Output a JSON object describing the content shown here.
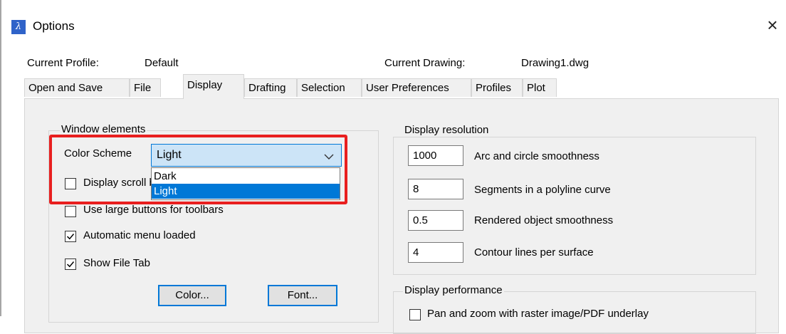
{
  "window": {
    "title": "Options",
    "close_glyph": "×"
  },
  "profile": {
    "label": "Current Profile:",
    "value": "Default"
  },
  "drawing": {
    "label": "Current Drawing:",
    "value": "Drawing1.dwg"
  },
  "tabs": [
    {
      "label": "Open and Save"
    },
    {
      "label": "File"
    },
    {
      "label": "Display",
      "active": true
    },
    {
      "label": "Drafting"
    },
    {
      "label": "Selection"
    },
    {
      "label": "User Preferences"
    },
    {
      "label": "Profiles"
    },
    {
      "label": "Plot"
    }
  ],
  "window_elements": {
    "title": "Window elements",
    "color_scheme": {
      "label": "Color Scheme",
      "value": "Light",
      "options": [
        "Dark",
        "Light"
      ],
      "selected": "Light"
    },
    "checkboxes": {
      "display_scroll": {
        "label": "Display scroll bars",
        "checked": false
      },
      "large_buttons": {
        "label": "Use large buttons for toolbars",
        "checked": false
      },
      "auto_menu": {
        "label": "Automatic menu loaded",
        "checked": true
      },
      "file_tab": {
        "label": "Show File Tab",
        "checked": true
      }
    },
    "color_button": "Color...",
    "font_button": "Font..."
  },
  "display_resolution": {
    "title": "Display resolution",
    "fields": [
      {
        "value": "1000",
        "label": "Arc and circle smoothness"
      },
      {
        "value": "8",
        "label": "Segments in a polyline curve"
      },
      {
        "value": "0.5",
        "label": "Rendered object smoothness"
      },
      {
        "value": "4",
        "label": "Contour lines per surface"
      }
    ]
  },
  "display_performance": {
    "title": "Display performance",
    "pan_zoom": {
      "label": "Pan and zoom with raster image/PDF underlay",
      "checked": false
    }
  },
  "colors": {
    "accent": "#0078d7",
    "highlight": "#e81f1f",
    "combo_bg": "#cce4f7",
    "panel_bg": "#f0f0f0"
  },
  "icons": {
    "app": "app-logo-icon",
    "close": "close-icon",
    "chevron": "chevron-down-icon",
    "check": "check-icon"
  }
}
